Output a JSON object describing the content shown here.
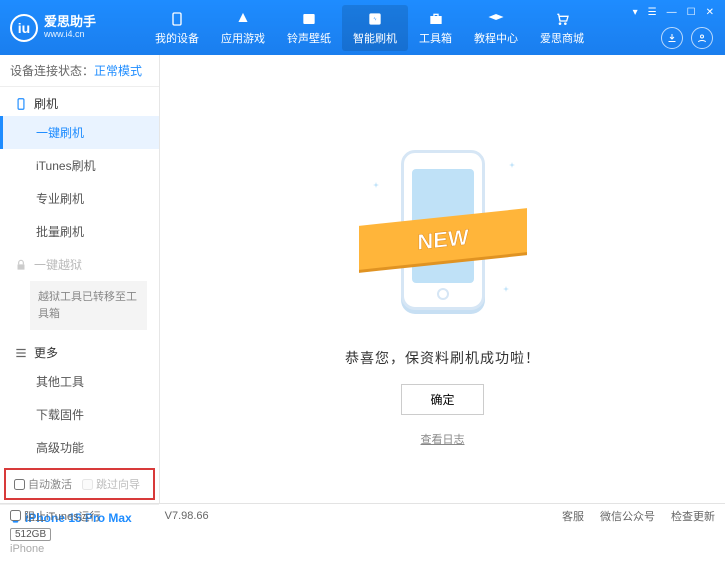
{
  "header": {
    "logo_letter": "iu",
    "title": "爱思助手",
    "subtitle": "www.i4.cn",
    "nav": [
      {
        "label": "我的设备"
      },
      {
        "label": "应用游戏"
      },
      {
        "label": "铃声壁纸"
      },
      {
        "label": "智能刷机"
      },
      {
        "label": "工具箱"
      },
      {
        "label": "教程中心"
      },
      {
        "label": "爱思商城"
      }
    ]
  },
  "sidebar": {
    "conn_label": "设备连接状态：",
    "conn_mode": "正常模式",
    "section_flash": "刷机",
    "items_flash": [
      "一键刷机",
      "iTunes刷机",
      "专业刷机",
      "批量刷机"
    ],
    "section_jailbreak": "一键越狱",
    "jailbreak_note": "越狱工具已转移至工具箱",
    "section_more": "更多",
    "items_more": [
      "其他工具",
      "下载固件",
      "高级功能"
    ],
    "cb_auto": "自动激活",
    "cb_skip": "跳过向导",
    "device_name": "iPhone 15 Pro Max",
    "device_storage": "512GB",
    "device_type": "iPhone"
  },
  "main": {
    "ribbon_text": "NEW",
    "success": "恭喜您，保资料刷机成功啦！",
    "ok": "确定",
    "view_log": "查看日志"
  },
  "footer": {
    "block_itunes": "阻止iTunes运行",
    "version": "V7.98.66",
    "links": [
      "客服",
      "微信公众号",
      "检查更新"
    ]
  }
}
